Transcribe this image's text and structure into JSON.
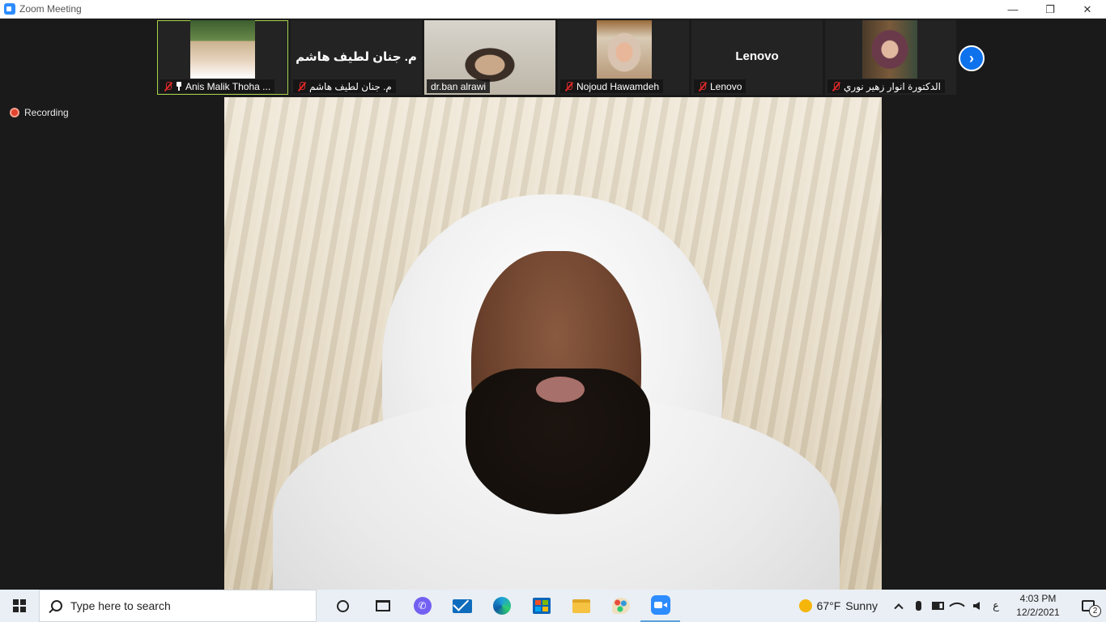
{
  "window": {
    "title": "Zoom Meeting",
    "minimize": "—",
    "restore": "❐",
    "close": "✕"
  },
  "meeting": {
    "recording_label": "Recording",
    "next_page_symbol": "›",
    "participants": [
      {
        "name": "Anis Malik Thoha ...",
        "big_label": "",
        "muted": true,
        "pinned": true,
        "has_video": true
      },
      {
        "name": "م. جنان لطيف هاشم",
        "big_label": "م. جنان لطيف هاشم",
        "muted": true,
        "pinned": false,
        "has_video": false
      },
      {
        "name": "dr.ban alrawi",
        "big_label": "",
        "muted": false,
        "pinned": false,
        "has_video": true
      },
      {
        "name": "Nojoud Hawamdeh",
        "big_label": "",
        "muted": true,
        "pinned": false,
        "has_video": true
      },
      {
        "name": "Lenovo",
        "big_label": "Lenovo",
        "muted": true,
        "pinned": false,
        "has_video": false
      },
      {
        "name": "الدكتورة انوار زهير نوري",
        "big_label": "",
        "muted": true,
        "pinned": false,
        "has_video": true
      }
    ]
  },
  "taskbar": {
    "search_placeholder": "Type here to search",
    "weather_temp": "67°F",
    "weather_text": "Sunny",
    "input_lang": "ع",
    "time": "4:03 PM",
    "date": "12/2/2021",
    "notification_count": "2"
  },
  "colors": {
    "accent": "#2d8cff",
    "active_tile_border": "#a5d34a",
    "muted_red": "#e02828",
    "recording_red": "#e0442e"
  }
}
